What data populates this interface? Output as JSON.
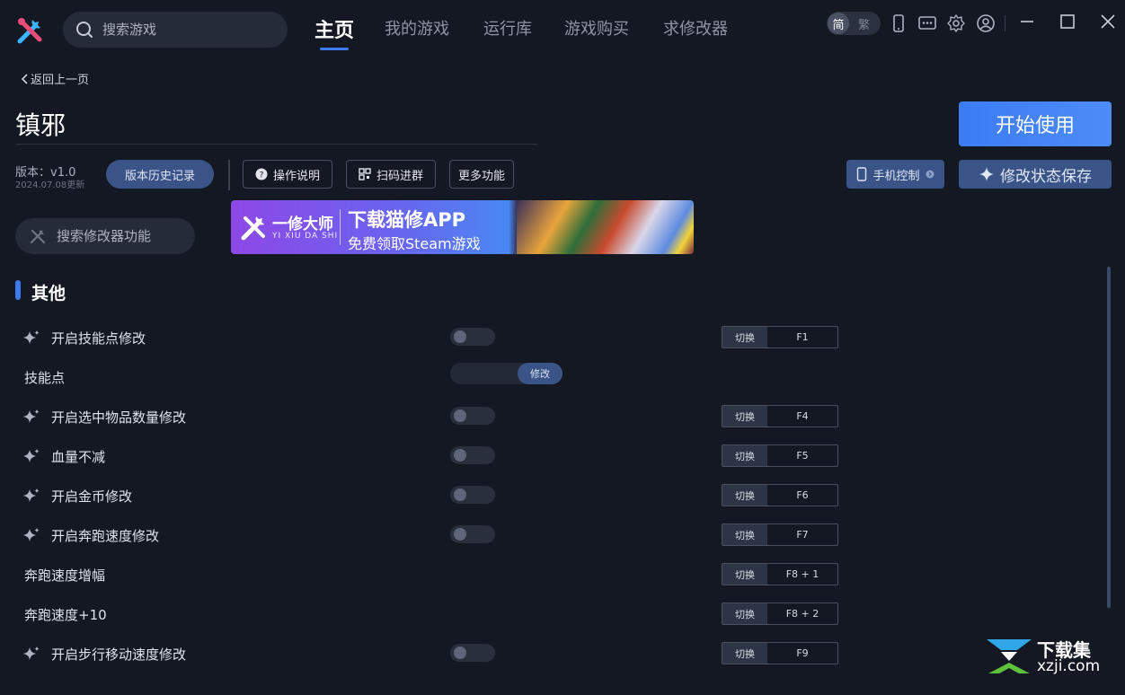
{
  "topbar": {
    "search_placeholder": "搜索游戏",
    "tabs": [
      {
        "label": "主页",
        "active": true
      },
      {
        "label": "我的游戏",
        "active": false
      },
      {
        "label": "运行库",
        "active": false
      },
      {
        "label": "游戏购买",
        "active": false
      },
      {
        "label": "求修改器",
        "active": false
      }
    ],
    "lang_simplified": "简",
    "lang_traditional": "繁"
  },
  "header": {
    "back_label": "返回上一页",
    "game_title": "镇邪",
    "start_button": "开始使用",
    "version": "版本：v1.0",
    "update_date": "2024.07.08更新",
    "history_button": "版本历史记录",
    "instructions_button": "操作说明",
    "qr_button": "扫码进群",
    "more_button": "更多功能",
    "phone_control_button": "手机控制",
    "save_state_button": "修改状态保存"
  },
  "banner": {
    "brand": "一修大师",
    "brand_sub": "YI XIU DA SHI",
    "headline": "下载猫修APP",
    "sub": "免费领取Steam游戏"
  },
  "feature_search_placeholder": "搜索修改器功能",
  "section": {
    "title": "其他"
  },
  "toggle_label": "切换",
  "edit_label": "修改",
  "rows": [
    {
      "label": "开启技能点修改",
      "spark": true,
      "control": "switch",
      "key": "F1"
    },
    {
      "label": "技能点",
      "spark": false,
      "control": "edit",
      "key": ""
    },
    {
      "label": "开启选中物品数量修改",
      "spark": true,
      "control": "switch",
      "key": "F4"
    },
    {
      "label": "血量不减",
      "spark": true,
      "control": "switch",
      "key": "F5"
    },
    {
      "label": "开启金币修改",
      "spark": true,
      "control": "switch",
      "key": "F6"
    },
    {
      "label": "开启奔跑速度修改",
      "spark": true,
      "control": "switch",
      "key": "F7"
    },
    {
      "label": "奔跑速度增幅",
      "spark": false,
      "control": "none",
      "key": "F8 + 1"
    },
    {
      "label": "奔跑速度+10",
      "spark": false,
      "control": "none",
      "key": "F8 + 2"
    },
    {
      "label": "开启步行移动速度修改",
      "spark": true,
      "control": "switch",
      "key": "F9"
    }
  ],
  "watermark": {
    "text": "下载集",
    "domain": "xzji.com"
  },
  "colors": {
    "accent": "#3d7bf2",
    "background": "#141823",
    "button_blue": "#3a5488"
  }
}
